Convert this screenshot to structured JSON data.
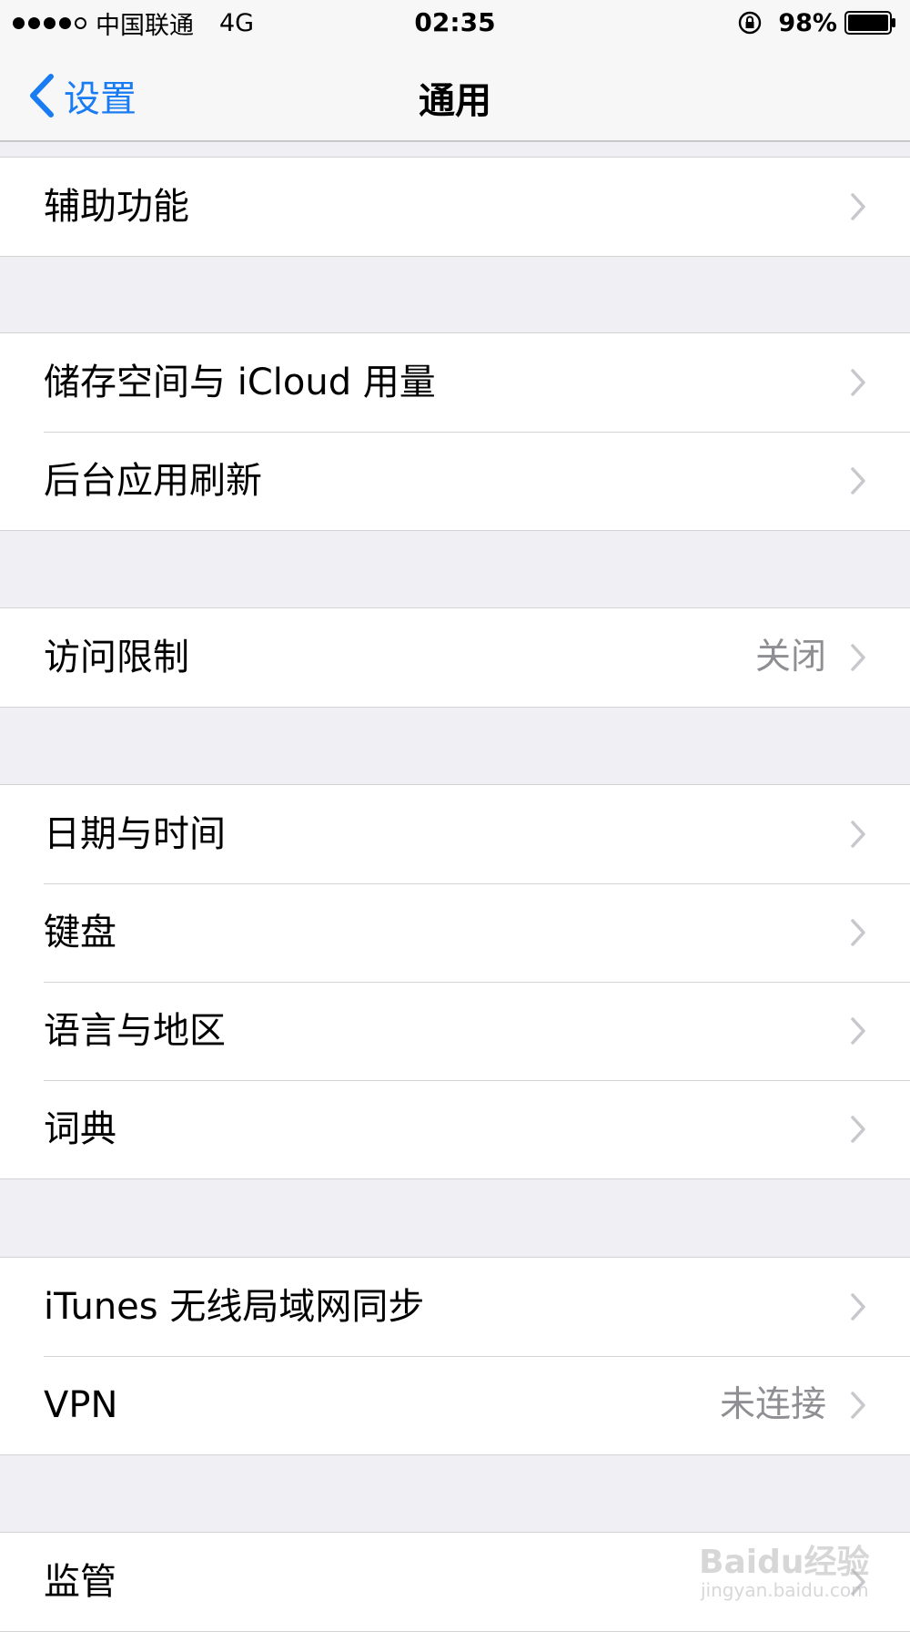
{
  "status_bar": {
    "carrier": "中国联通",
    "network": "4G",
    "time": "02:35",
    "battery": "98%",
    "signal_bars": 4
  },
  "nav": {
    "back_label": "设置",
    "title": "通用"
  },
  "groups": [
    {
      "rows": [
        {
          "label": "辅助功能",
          "detail": ""
        }
      ]
    },
    {
      "rows": [
        {
          "label": "储存空间与 iCloud 用量",
          "detail": ""
        },
        {
          "label": "后台应用刷新",
          "detail": ""
        }
      ]
    },
    {
      "rows": [
        {
          "label": "访问限制",
          "detail": "关闭"
        }
      ]
    },
    {
      "rows": [
        {
          "label": "日期与时间",
          "detail": ""
        },
        {
          "label": "键盘",
          "detail": ""
        },
        {
          "label": "语言与地区",
          "detail": ""
        },
        {
          "label": "词典",
          "detail": ""
        }
      ]
    },
    {
      "rows": [
        {
          "label": "iTunes 无线局域网同步",
          "detail": ""
        },
        {
          "label": "VPN",
          "detail": "未连接"
        }
      ]
    },
    {
      "rows": [
        {
          "label": "监管",
          "detail": ""
        }
      ]
    }
  ],
  "watermark": {
    "text": "Baidu经验",
    "sub": "jingyan.baidu.com"
  },
  "colors": {
    "accent": "#1a7cf2",
    "background": "#efeff4",
    "detail": "#8e8e93"
  }
}
